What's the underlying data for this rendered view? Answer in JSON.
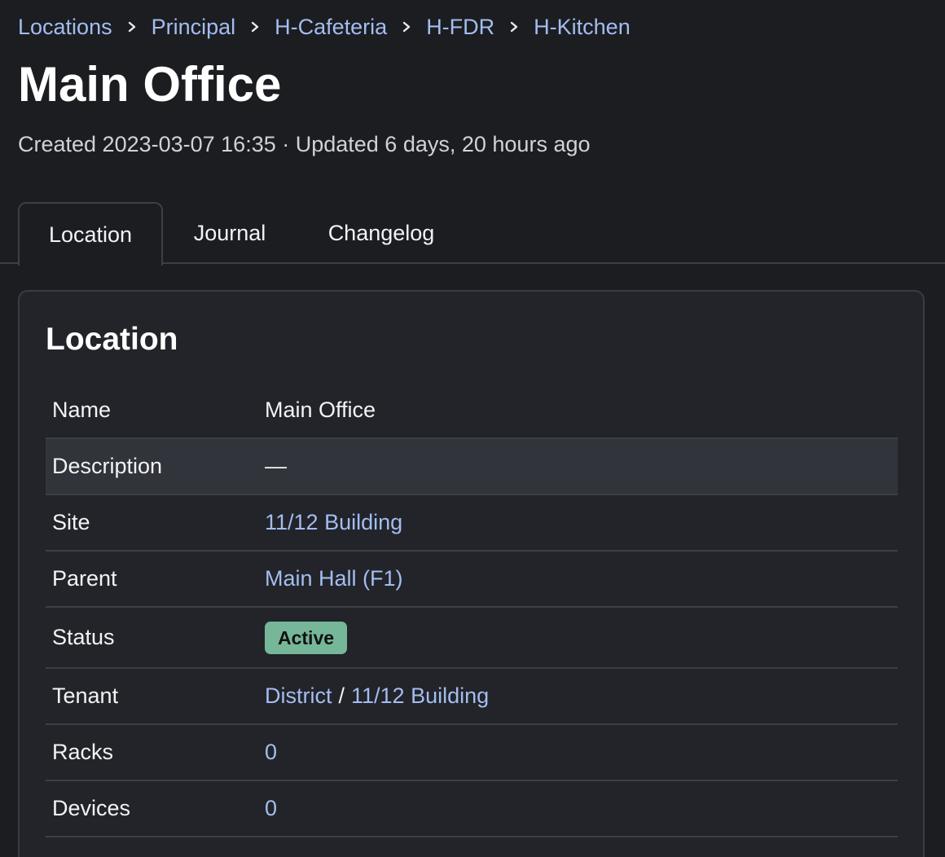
{
  "breadcrumb": {
    "items": [
      "Locations",
      "Principal",
      "H-Cafeteria",
      "H-FDR",
      "H-Kitchen"
    ],
    "separator_icon": "chevron-right-icon"
  },
  "page": {
    "title": "Main Office",
    "meta": "Created 2023-03-07 16:35 · Updated 6 days, 20 hours ago"
  },
  "tabs": [
    {
      "label": "Location",
      "active": true
    },
    {
      "label": "Journal",
      "active": false
    },
    {
      "label": "Changelog",
      "active": false
    }
  ],
  "card": {
    "title": "Location",
    "rows": {
      "name": {
        "label": "Name",
        "value": "Main Office"
      },
      "description": {
        "label": "Description",
        "value": "—"
      },
      "site": {
        "label": "Site",
        "value": "11/12 Building"
      },
      "parent": {
        "label": "Parent",
        "value": "Main Hall (F1)"
      },
      "status": {
        "label": "Status",
        "value": "Active"
      },
      "tenant": {
        "label": "Tenant",
        "group": "District",
        "divider": "/",
        "value": "11/12 Building"
      },
      "racks": {
        "label": "Racks",
        "value": "0"
      },
      "devices": {
        "label": "Devices",
        "value": "0"
      }
    }
  },
  "colors": {
    "background": "#1b1d21",
    "card": "#222429",
    "link": "#a3bdf0",
    "status_active": "#75b798"
  }
}
